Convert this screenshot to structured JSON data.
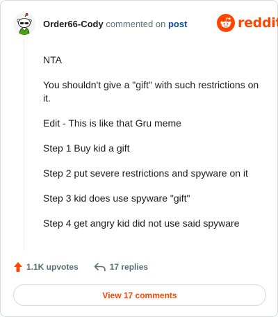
{
  "header": {
    "username": "Order66-Cody",
    "commented_text": "commented on",
    "post_link": "post",
    "brand": "reddit",
    "brand_color": "#ff4500"
  },
  "comment": {
    "paragraphs": [
      "NTA",
      "You shouldn't give a \"gift\" with such restrictions on it.",
      "Edit - This is like that Gru meme",
      "Step 1 Buy kid a gift",
      "Step 2 put severe restrictions and spyware on it",
      "Step 3 kid does use spyware \"gift\"",
      "Step 4 get angry kid did not use said spyware"
    ]
  },
  "footer": {
    "upvotes": "1.1K upvotes",
    "replies": "17 replies",
    "view_button": "View 17 comments"
  },
  "icons": {
    "avatar": "snoo-avatar-icon",
    "logo": "reddit-logo-icon",
    "upvote": "upvote-arrow-icon",
    "reply": "reply-arrow-icon"
  }
}
